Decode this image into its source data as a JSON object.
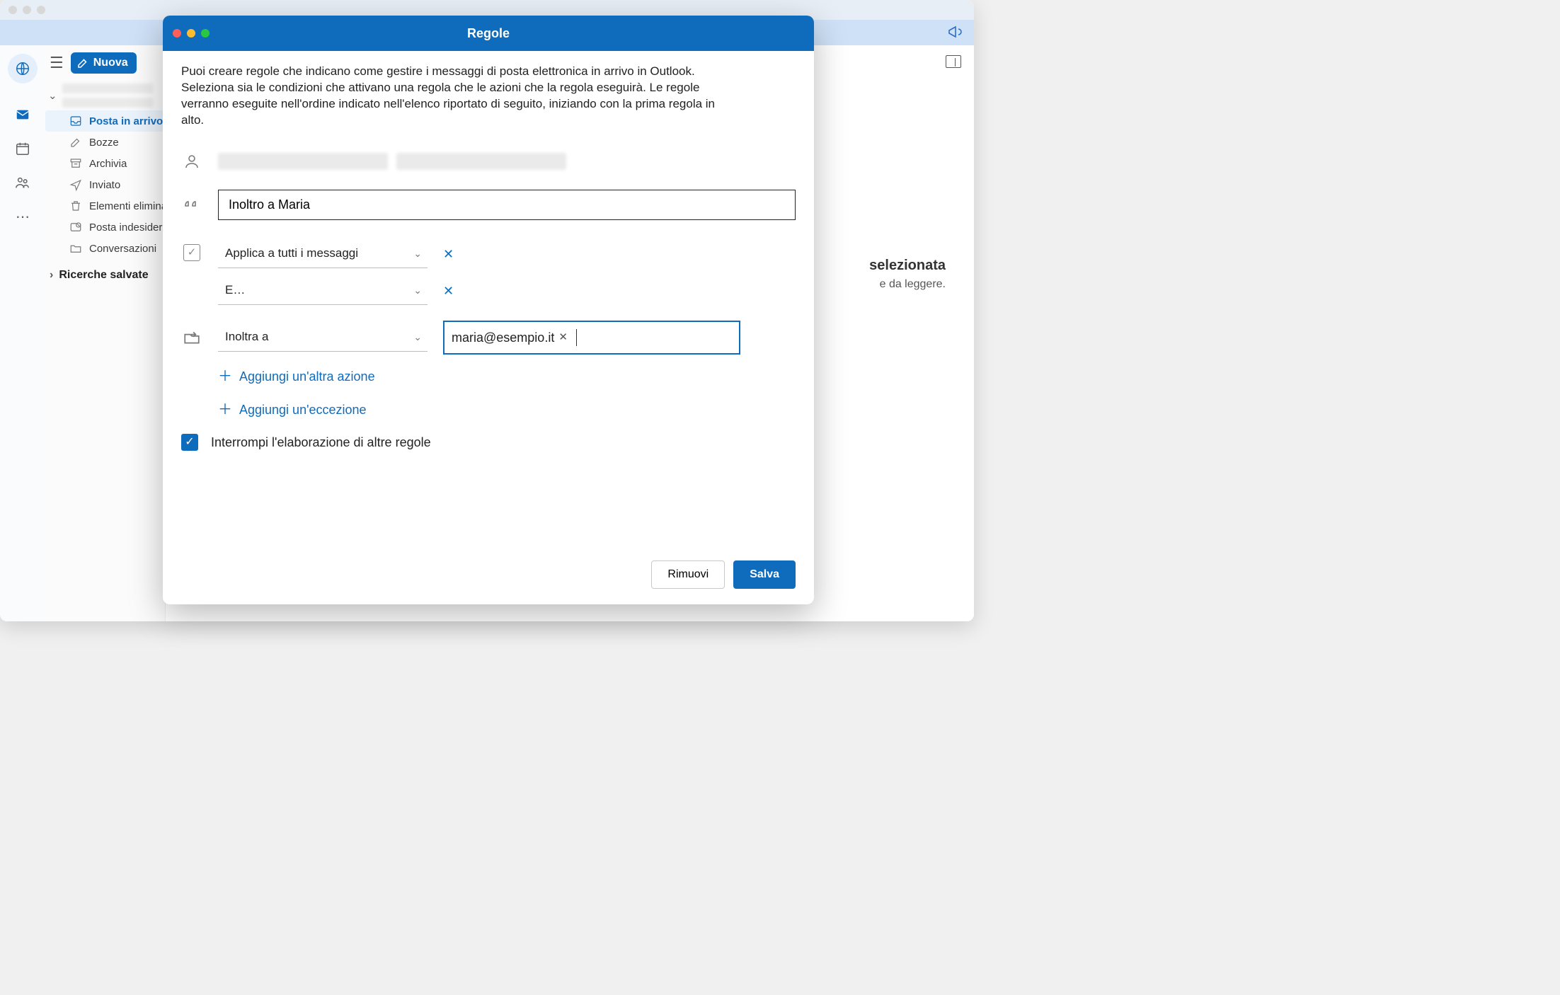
{
  "outlook": {
    "new_mail_label": "Nuova",
    "folders": {
      "inbox": "Posta in arrivo",
      "drafts": "Bozze",
      "archive": "Archivia",
      "sent": "Inviato",
      "deleted": "Elementi eliminati",
      "junk": "Posta indesiderata",
      "conversations": "Conversazioni"
    },
    "saved_searches": "Ricerche salvate",
    "reading_pane": {
      "line1": "selezionata",
      "line2": "e da leggere."
    }
  },
  "modal": {
    "title": "Regole",
    "description": "Puoi creare regole che indicano come gestire i messaggi di posta elettronica in arrivo in Outlook. Seleziona sia le condizioni che attivano una regola che le azioni che la regola eseguirà. Le regole verranno eseguite nell'ordine indicato nell'elenco riportato di seguito, iniziando con la prima regola in alto.",
    "rule_name": "Inoltro a Maria",
    "condition1": "Applica a tutti i messaggi",
    "condition2": "E…",
    "action_label": "Inoltra a",
    "recipient": "maria@esempio.it",
    "add_action": "Aggiungi un'altra azione",
    "add_exception": "Aggiungi un'eccezione",
    "stop_processing": "Interrompi l'elaborazione di altre regole",
    "remove_btn": "Rimuovi",
    "save_btn": "Salva"
  }
}
